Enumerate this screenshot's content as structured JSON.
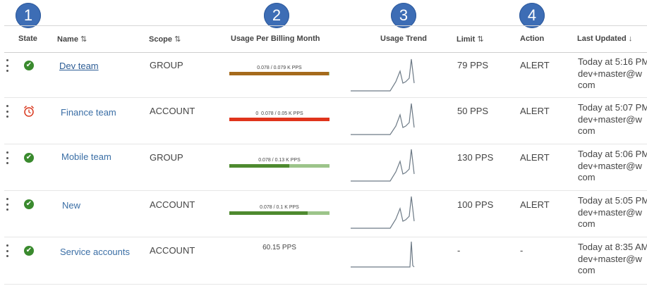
{
  "callouts": [
    "1",
    "2",
    "3",
    "4"
  ],
  "columns": {
    "state": "State",
    "name": "Name",
    "scope": "Scope",
    "usage": "Usage Per Billing Month",
    "trend": "Usage Trend",
    "limit": "Limit",
    "action": "Action",
    "updated": "Last Updated",
    "sort_icon": "⇅",
    "sort_desc_icon": "↓"
  },
  "rows": [
    {
      "state": "ok",
      "name": "Dev team",
      "scope": "GROUP",
      "usage": "0.078 / 0.079 K PPS",
      "usage_fraction": 0.99,
      "bar_color": "#a56a1c",
      "limit": "79 PPS",
      "action": "ALERT",
      "updated": [
        "Today at 5:16 PM",
        "dev+master@w",
        "com"
      ]
    },
    {
      "state": "alarm",
      "name": "Finance team",
      "scope": "ACCOUNT",
      "usage": "0.078 / 0.05 K PPS",
      "usage_marker": "0",
      "usage_fraction": 1.0,
      "bar_color": "#e0341c",
      "limit": "50 PPS",
      "action": "ALERT",
      "updated": [
        "Today at 5:07 PM",
        "dev+master@w",
        "com"
      ]
    },
    {
      "state": "ok",
      "name": "Mobile team",
      "scope": "GROUP",
      "usage": "0.078 / 0.13 K PPS",
      "usage_fraction": 0.6,
      "bar_color": "#4e8a2f",
      "limit": "130 PPS",
      "action": "ALERT",
      "updated": [
        "Today at 5:06 PM",
        "dev+master@w",
        "com"
      ]
    },
    {
      "state": "ok",
      "name": "New",
      "scope": "ACCOUNT",
      "usage": "0.078 / 0.1 K PPS",
      "usage_fraction": 0.78,
      "bar_color": "#4e8a2f",
      "limit": "100 PPS",
      "action": "ALERT",
      "updated": [
        "Today at 5:05 PM",
        "dev+master@w",
        "com"
      ]
    },
    {
      "state": "ok",
      "name": "Service accounts",
      "scope": "ACCOUNT",
      "usage": "60.15 PPS",
      "limit": "-",
      "action": "-",
      "updated": [
        "Today at 8:35 AM",
        "dev+master@w",
        "com"
      ]
    }
  ],
  "colors": {
    "callout": "#3d6db5",
    "ok": "#3a8a2e",
    "alarm": "#d9381e",
    "bar_track": "#9cc48a",
    "link": "#3a6ea5"
  }
}
